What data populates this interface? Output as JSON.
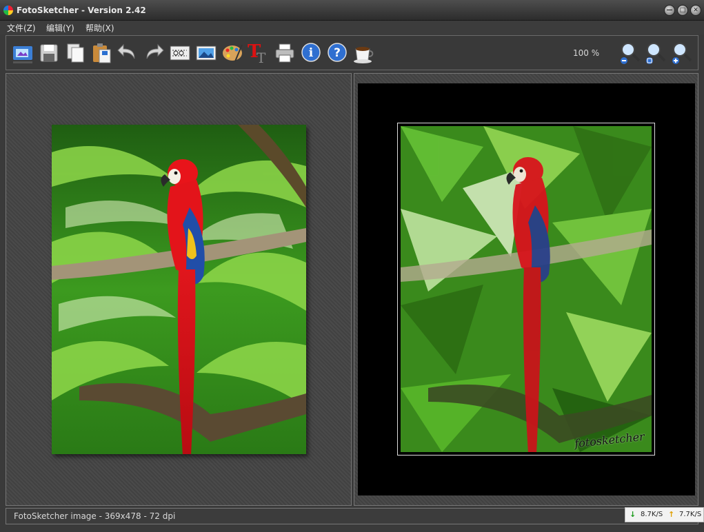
{
  "window": {
    "title": "FotoSketcher - Version 2.42"
  },
  "menu": {
    "items": [
      "文件(Z)",
      "编辑(Y)",
      "帮助(X)"
    ]
  },
  "toolbar": {
    "buttons": [
      {
        "name": "open-image",
        "icon": "folder-picture-icon"
      },
      {
        "name": "save",
        "icon": "floppy-disk-icon"
      },
      {
        "name": "copy",
        "icon": "copy-icon"
      },
      {
        "name": "paste",
        "icon": "paste-icon"
      },
      {
        "name": "undo",
        "icon": "undo-arrow-icon"
      },
      {
        "name": "redo",
        "icon": "redo-arrow-icon"
      },
      {
        "name": "crop",
        "icon": "crop-scissors-icon"
      },
      {
        "name": "image-adjust",
        "icon": "landscape-image-icon"
      },
      {
        "name": "drawing-parameters",
        "icon": "palette-icon"
      },
      {
        "name": "add-text",
        "icon": "text-tt-icon"
      },
      {
        "name": "print",
        "icon": "printer-icon"
      },
      {
        "name": "about",
        "icon": "info-icon"
      },
      {
        "name": "help",
        "icon": "help-question-icon"
      },
      {
        "name": "donate",
        "icon": "coffee-cup-icon"
      }
    ],
    "zoom_label": "100 %",
    "zoom_buttons": [
      {
        "name": "zoom-out",
        "icon": "zoom-out-icon"
      },
      {
        "name": "zoom-fit",
        "icon": "zoom-fit-icon"
      },
      {
        "name": "zoom-in",
        "icon": "zoom-in-icon"
      }
    ]
  },
  "panels": {
    "original": {
      "description": "scarlet macaw perched on branch among palm fronds"
    },
    "sketch": {
      "signature": "fotosketcher"
    }
  },
  "status": {
    "text": "FotoSketcher image - 369x478 - 72 dpi"
  },
  "network": {
    "down": "8.7K/S",
    "up": "7.7K/S",
    "down_color": "#1a9a1a",
    "up_color": "#e0a000"
  },
  "colors": {
    "accent_red": "#d8141c",
    "leaf_green": "#3fae22",
    "background": "#3a3a3a"
  }
}
